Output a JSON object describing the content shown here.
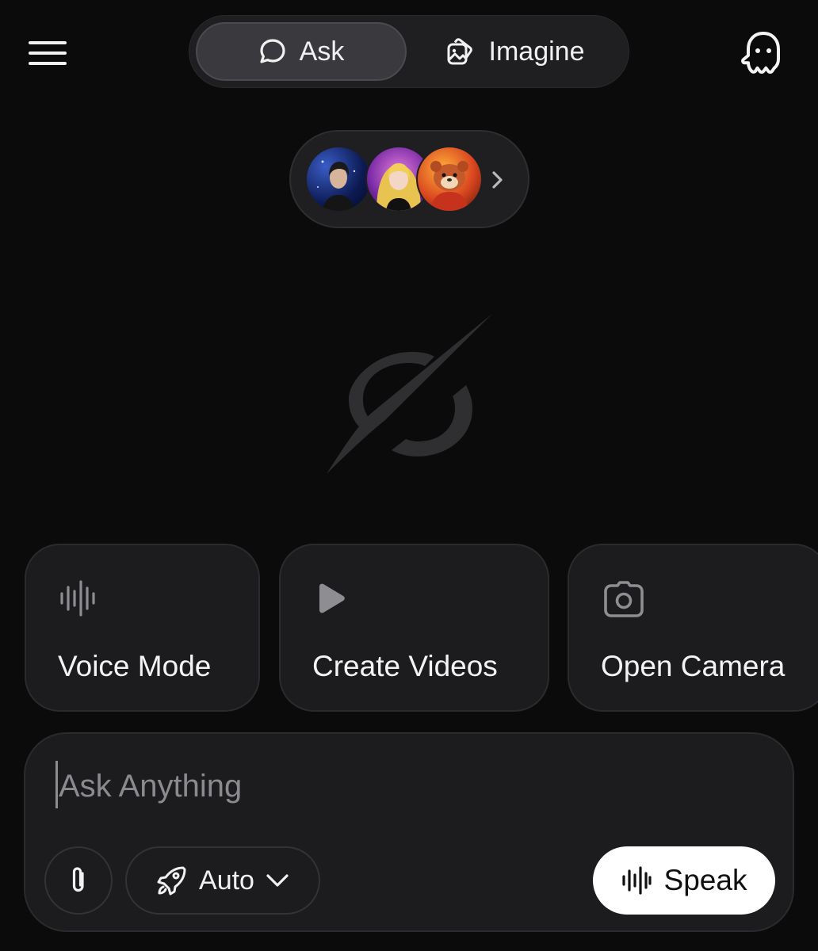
{
  "header": {
    "menu_icon": "hamburger-menu-icon",
    "tabs": [
      {
        "label": "Ask",
        "icon": "chat-bubble-icon",
        "selected": true
      },
      {
        "label": "Imagine",
        "icon": "image-stack-icon",
        "selected": false
      }
    ],
    "private_icon": "ghost-icon"
  },
  "companions": {
    "avatars": [
      "companion-avatar-1",
      "companion-avatar-2",
      "companion-avatar-3"
    ],
    "more_icon": "chevron-right-icon"
  },
  "logo": "grok-logo",
  "actions": [
    {
      "label": "Voice Mode",
      "icon": "waveform-icon"
    },
    {
      "label": "Create Videos",
      "icon": "play-icon"
    },
    {
      "label": "Open Camera",
      "icon": "camera-icon"
    }
  ],
  "composer": {
    "placeholder": "Ask Anything",
    "value": "",
    "attach_icon": "paperclip-icon",
    "mode_label": "Auto",
    "mode_icon": "rocket-icon",
    "speak_label": "Speak",
    "speak_icon": "waveform-icon"
  },
  "colors": {
    "background": "#0b0b0c",
    "surface": "#1c1c1e",
    "selected_tab": "#3a3a3e",
    "speak_button": "#ffffff"
  }
}
